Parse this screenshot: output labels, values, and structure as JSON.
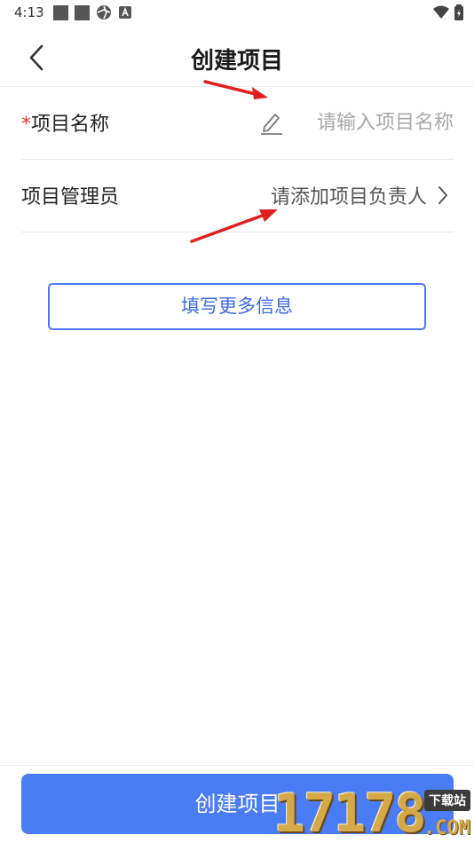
{
  "status_bar": {
    "time": "4:13",
    "icons": [
      "notification-square-icon",
      "notification-square-icon",
      "aperture-icon",
      "a-badge-icon"
    ],
    "right_icons": [
      "wifi-icon",
      "battery-charging-icon"
    ]
  },
  "header": {
    "title": "创建项目",
    "back_icon": "chevron-left-icon"
  },
  "form": {
    "project_name": {
      "required_mark": "*",
      "label": "项目名称",
      "placeholder": "请输入项目名称",
      "value": "",
      "icon": "pencil-icon"
    },
    "project_manager": {
      "label": "项目管理员",
      "value": "请添加项目负责人",
      "icon": "chevron-right-icon"
    }
  },
  "more_info_button": {
    "label": "填写更多信息"
  },
  "create_button": {
    "label": "创建项目"
  },
  "watermark": {
    "number": "17178",
    "tag": "下载站",
    "domain": ".COM"
  },
  "colors": {
    "accent": "#4a7cf6",
    "outline_button": "#3d6be8",
    "required": "#e53935",
    "annotation_arrow": "#e02020",
    "placeholder": "#a8a8a8"
  }
}
